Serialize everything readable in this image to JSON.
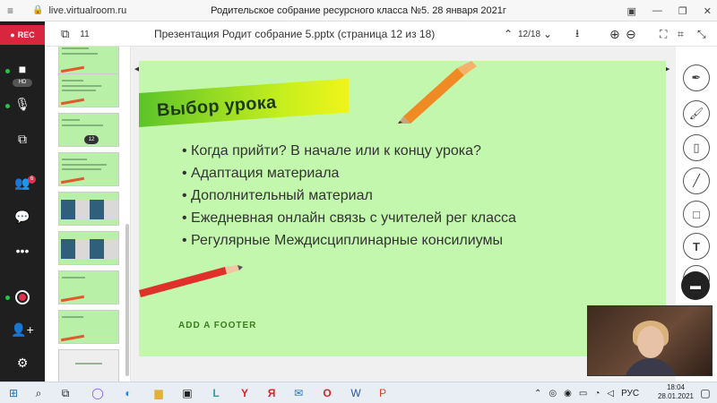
{
  "browser": {
    "url": "live.virtualroom.ru",
    "window_title": "Родительское собрание ресурсного класса №5. 28 января 2021г"
  },
  "rail": {
    "rec_label": "REC",
    "cam_pill": "HD",
    "participants_badge": "6"
  },
  "toolbar": {
    "slides_count": "11",
    "document_title": "Презентация Родит собрание 5.pptx (страница 12 из 18)",
    "page_indicator": "12/18"
  },
  "thumbnails": {
    "current_badge": "12"
  },
  "slide": {
    "title": "Выбор урока",
    "bullets": [
      "Когда прийти? В начале или к концу урока?",
      "Адаптация материала",
      "Дополнительный материал",
      "Ежедневная онлайн связь с учителей рег класса",
      "Регулярные Междисциплинарные консилиумы"
    ],
    "footer": "ADD A FOOTER"
  },
  "taskbar": {
    "lang": "РУС",
    "time": "18:04",
    "date": "28.01.2021"
  },
  "colors": {
    "slide_bg": "#c3f7ad",
    "rec_red": "#d7263d",
    "rail_bg": "#1f1f1f"
  }
}
